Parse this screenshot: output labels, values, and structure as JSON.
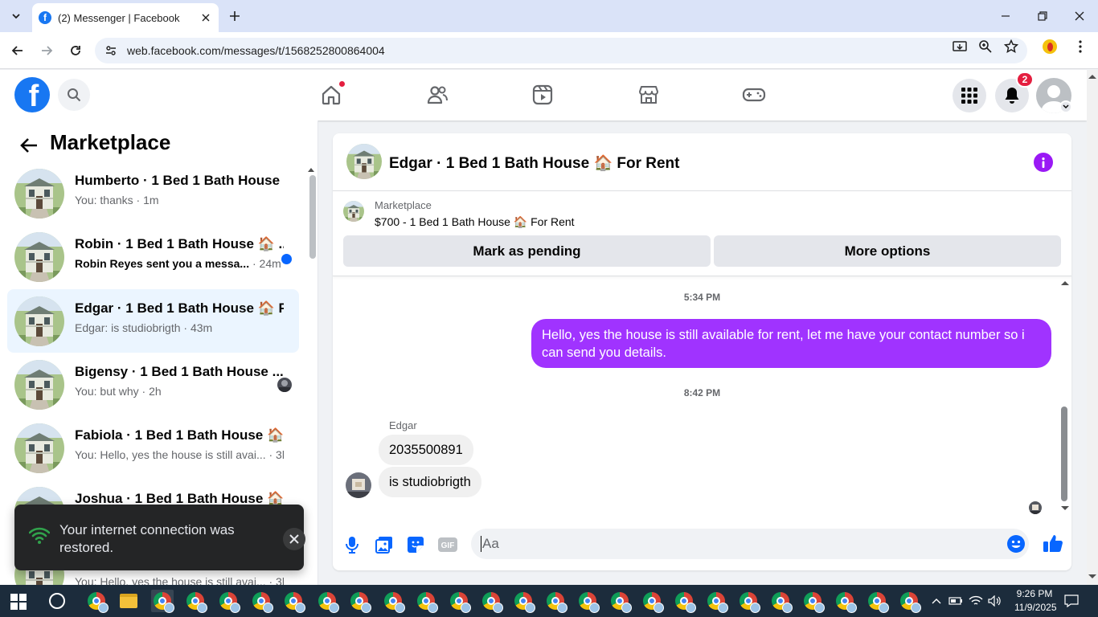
{
  "browser": {
    "tab_title": "(2) Messenger | Facebook",
    "url": "web.facebook.com/messages/t/1568252800864004"
  },
  "fb_header": {
    "notification_count": "2"
  },
  "left_panel": {
    "title": "Marketplace",
    "conversations": [
      {
        "name": "Humberto · 1 Bed 1 Bath House ...",
        "preview": "You: thanks · 1m",
        "unread": false,
        "active": false
      },
      {
        "name": "Robin · 1 Bed 1 Bath House 🏠 ...",
        "preview": "Robin Reyes sent you a messa...",
        "time": " · 24m",
        "unread": true,
        "active": false
      },
      {
        "name": "Edgar · 1 Bed 1 Bath House 🏠 F...",
        "preview": "Edgar: is studiobrigth · 43m",
        "unread": false,
        "active": true
      },
      {
        "name": "Bigensy · 1 Bed 1 Bath House ...",
        "preview": "You: but why · 2h",
        "unread": false,
        "active": false
      },
      {
        "name": "Fabiola · 1 Bed 1 Bath House 🏠 ...",
        "preview": "You: Hello, yes the house is still avai... · 3h",
        "unread": false,
        "active": false
      },
      {
        "name": "Joshua · 1 Bed 1 Bath House 🏠 F...",
        "preview": "",
        "unread": false,
        "active": false
      },
      {
        "name": "",
        "preview": "You: Hello, yes the house is still avai... · 3h",
        "unread": false,
        "active": false
      }
    ]
  },
  "toast": {
    "message": "Your internet connection was restored."
  },
  "chat": {
    "title": "Edgar · 1 Bed 1 Bath House 🏠 For Rent",
    "marketplace_label": "Marketplace",
    "listing": "$700 - 1 Bed 1 Bath House 🏠 For Rent",
    "mark_pending_label": "Mark as pending",
    "more_options_label": "More options",
    "timestamp_1": "5:34 PM",
    "outgoing_message": "Hello, yes the house is still available for rent, let me have your contact number so i can send you  details.",
    "timestamp_2": "8:42 PM",
    "sender_name": "Edgar",
    "incoming_1": "2035500891",
    "incoming_2": "is studiobrigth",
    "composer_placeholder": "Aa"
  },
  "taskbar": {
    "time": "9:26 PM",
    "date": "11/9/2025"
  },
  "colors": {
    "fb_blue": "#1877f2",
    "outgoing_bubble": "#a033ff",
    "messenger_icon": "#0866ff",
    "active_row": "#ebf5ff"
  }
}
